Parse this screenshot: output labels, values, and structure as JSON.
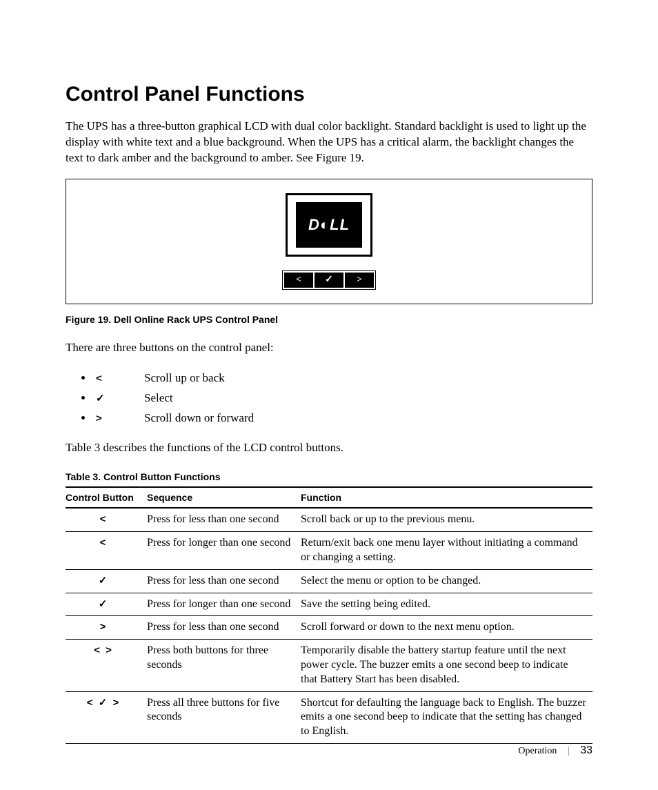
{
  "title": "Control Panel Functions",
  "intro": "The UPS has a three-button graphical LCD with dual color backlight. Standard backlight is used to light up the display with white text and a blue background. When the UPS has a critical alarm, the backlight changes the text to dark amber and the background to amber. See Figure 19.",
  "figure": {
    "logo_text": "D◐LL",
    "buttons": {
      "left": "<",
      "mid": "✓",
      "right": ">"
    },
    "caption": "Figure 19. Dell Online Rack UPS Control Panel"
  },
  "buttons_intro": "There are three buttons on the control panel:",
  "button_list": [
    {
      "icon": "<",
      "label": "Scroll up or back"
    },
    {
      "icon": "✓",
      "label": "Select"
    },
    {
      "icon": ">",
      "label": "Scroll down or forward"
    }
  ],
  "table_intro": "Table 3 describes the functions of the LCD control buttons.",
  "table": {
    "caption": "Table 3. Control Button Functions",
    "headers": {
      "btn": "Control Button",
      "seq": "Sequence",
      "func": "Function"
    },
    "rows": [
      {
        "btn": "<",
        "seq": "Press for less than one second",
        "func": "Scroll back or up to the previous menu."
      },
      {
        "btn": "<",
        "seq": "Press for longer than one second",
        "func": "Return/exit back one menu layer without initiating a command or changing a setting."
      },
      {
        "btn": "✓",
        "seq": "Press for less than one second",
        "func": "Select the menu or option to be changed."
      },
      {
        "btn": "✓",
        "seq": "Press for longer than one second",
        "func": "Save the setting being edited."
      },
      {
        "btn": ">",
        "seq": "Press for less than one second",
        "func": "Scroll forward or down to the next menu option."
      },
      {
        "btn": "<   >",
        "seq": "Press both buttons for three seconds",
        "func": "Temporarily disable the battery startup feature until the next power cycle. The buzzer emits a one second beep to indicate that Battery Start has been disabled."
      },
      {
        "btn": "<  ✓  >",
        "seq": "Press all three buttons for five seconds",
        "func": "Shortcut for defaulting the language back to English. The buzzer emits a one second beep to indicate that the setting has changed to English."
      }
    ]
  },
  "footer": {
    "section": "Operation",
    "page": "33"
  }
}
